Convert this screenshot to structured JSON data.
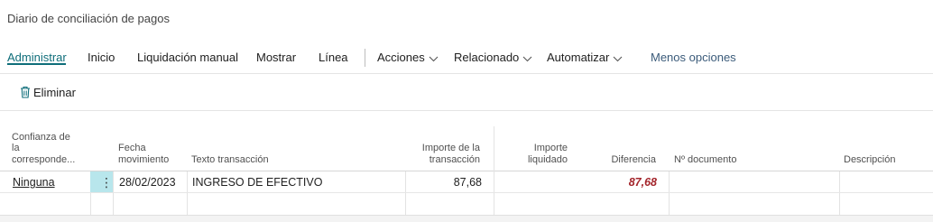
{
  "page": {
    "title": "Diario de conciliación de pagos"
  },
  "actionbar": {
    "tabs": [
      "Administrar",
      "Inicio",
      "Liquidación manual",
      "Mostrar",
      "Línea"
    ],
    "menus": [
      "Acciones",
      "Relacionado",
      "Automatizar"
    ],
    "less_options": "Menos opciones"
  },
  "toolbar": {
    "delete_label": "Eliminar"
  },
  "grid": {
    "headers": {
      "confianza": [
        "Confianza de",
        "la",
        "corresponde..."
      ],
      "fecha": [
        "Fecha",
        "movimiento"
      ],
      "texto": "Texto transacción",
      "importe_trans": [
        "Importe de la",
        "transacción"
      ],
      "importe_liq": [
        "Importe",
        "liquidado"
      ],
      "diferencia": "Diferencia",
      "documento": "Nº documento",
      "descripcion": "Descripción"
    },
    "rows": [
      {
        "confianza": "Ninguna",
        "menu_glyph": "⋮",
        "fecha": "28/02/2023",
        "texto": "INGRESO DE EFECTIVO",
        "importe_trans": "87,68",
        "importe_liq": "",
        "diferencia": "87,68",
        "documento": "",
        "descripcion": ""
      }
    ]
  },
  "colors": {
    "accent": "#0f6e7a",
    "negative": "#a4262c",
    "selected_cell": "#b8e6ec"
  }
}
